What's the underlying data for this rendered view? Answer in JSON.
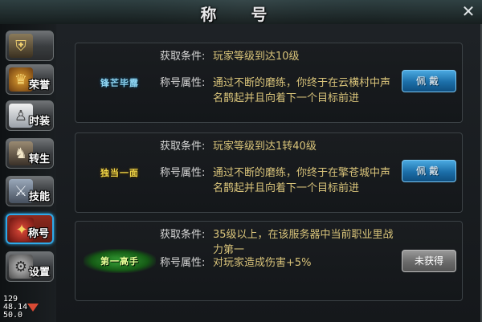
{
  "window": {
    "title": "称 号"
  },
  "sidebar": {
    "items": [
      {
        "label": "",
        "icon": "shield-icon",
        "color": "#6b5e4a"
      },
      {
        "label": "荣誉",
        "icon": "crest-icon",
        "color": "#b07a2a"
      },
      {
        "label": "时装",
        "icon": "costume-icon",
        "color": "#d8d8d8"
      },
      {
        "label": "转生",
        "icon": "rebirth-icon",
        "color": "#8a7a6a"
      },
      {
        "label": "技能",
        "icon": "skill-icon",
        "color": "#7a8aa0"
      },
      {
        "label": "称号",
        "icon": "title-icon",
        "color": "#c0302a"
      },
      {
        "label": "设置",
        "icon": "gear-icon",
        "color": "#8a8a8a"
      }
    ],
    "active_index": 5
  },
  "stats": {
    "lines": [
      "129",
      "48.14",
      "50.0"
    ]
  },
  "titles": [
    {
      "badge": "锋芒毕露",
      "badge_color": "#8fd4f0",
      "condition_label": "获取条件:",
      "condition": "玩家等级到达10级",
      "attr_label": "称号属性:",
      "attr": "通过不断的磨练，你终于在云横村中声名鹊起并且向着下一个目标前进",
      "button": "佩戴",
      "button_state": "wear"
    },
    {
      "badge": "独当一面",
      "badge_color": "#f2d84a",
      "condition_label": "获取条件:",
      "condition": "玩家等级到达1转40级",
      "attr_label": "称号属性:",
      "attr": "通过不断的磨练，你终于在擎苍城中声名鹊起并且向着下一个目标前进",
      "button": "佩戴",
      "button_state": "wear"
    },
    {
      "badge": "第一高手",
      "badge_color": "#5ee05a",
      "condition_label": "获取条件:",
      "condition": "35级以上，在该服务器中当前职业里战力第一",
      "attr_label": "称号属性:",
      "attr": "对玩家造成伤害+5%",
      "button": "未获得",
      "button_state": "locked"
    }
  ]
}
